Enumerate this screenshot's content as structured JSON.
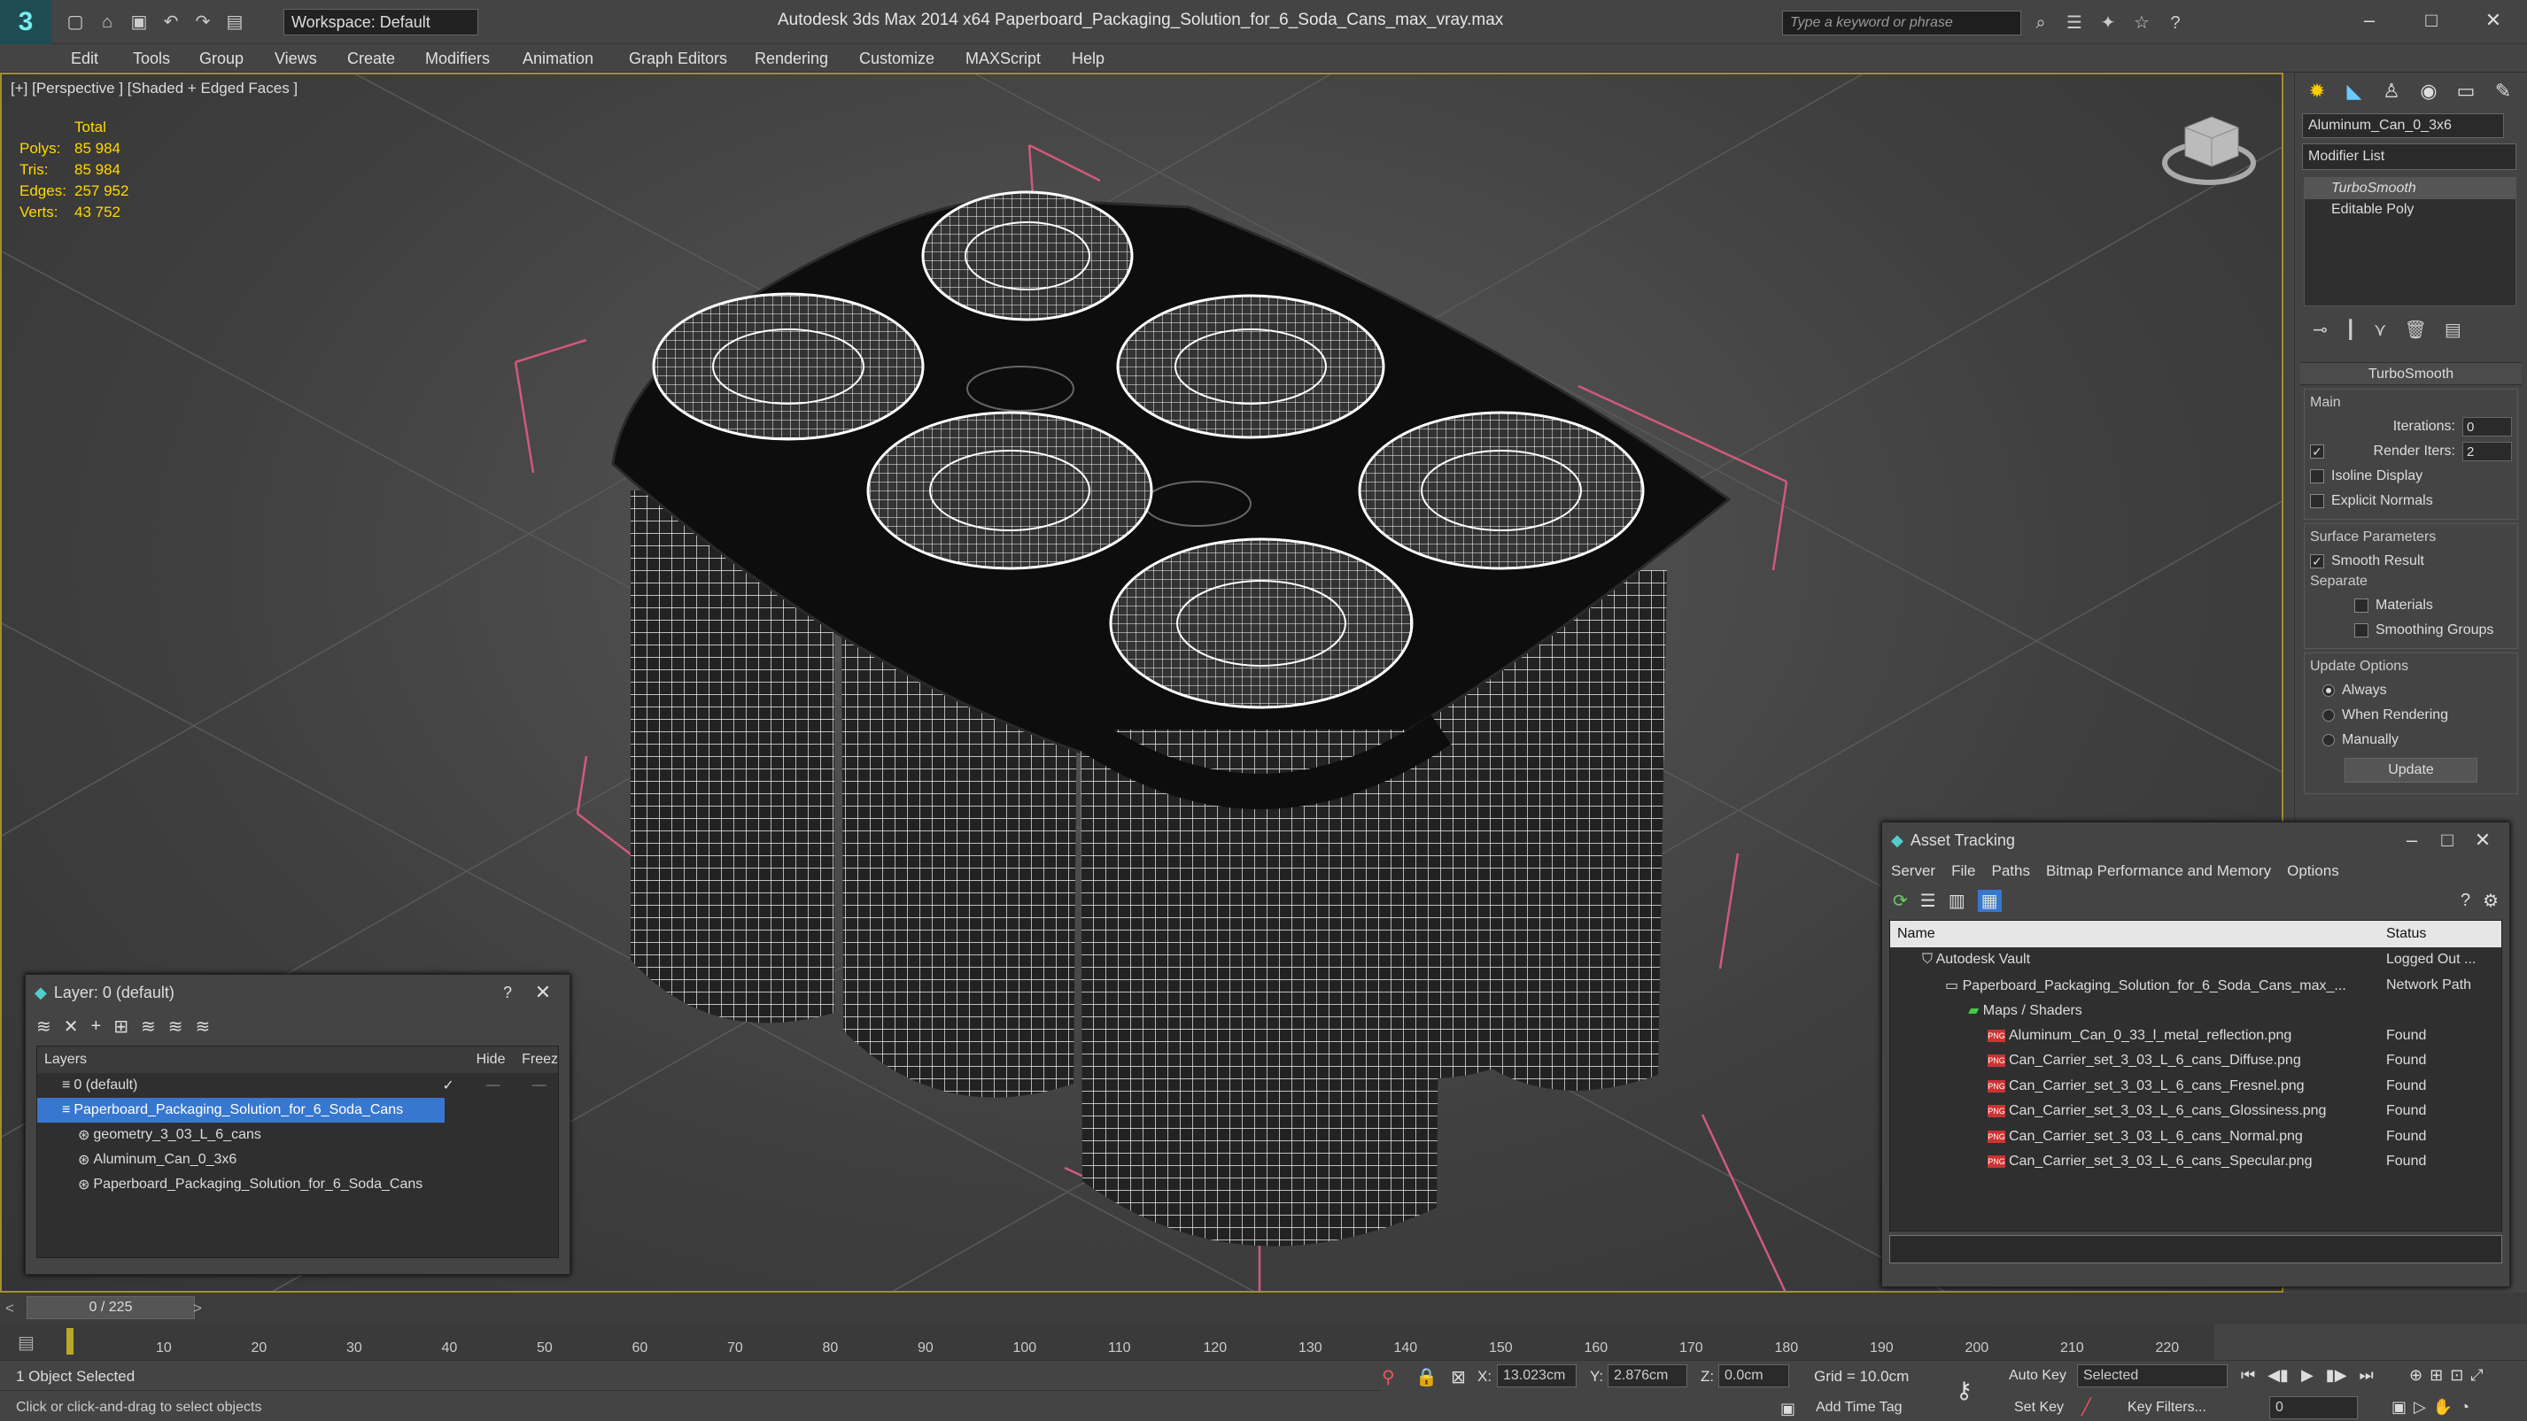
{
  "app": {
    "logo": "3",
    "workspace": "Workspace: Default",
    "title": "Autodesk 3ds Max  2014 x64     Paperboard_Packaging_Solution_for_6_Soda_Cans_max_vray.max",
    "search_placeholder": "Type a keyword or phrase"
  },
  "menu": [
    "Edit",
    "Tools",
    "Group",
    "Views",
    "Create",
    "Modifiers",
    "Animation",
    "Graph Editors",
    "Rendering",
    "Customize",
    "MAXScript",
    "Help"
  ],
  "viewport": {
    "label": "[+] [Perspective ] [Shaded + Edged Faces ]",
    "stats": {
      "total_label": "Total",
      "rows": [
        {
          "k": "Polys:",
          "v": "85 984"
        },
        {
          "k": "Tris:",
          "v": "85 984"
        },
        {
          "k": "Edges:",
          "v": "257 952"
        },
        {
          "k": "Verts:",
          "v": "43 752"
        }
      ]
    }
  },
  "command_panel": {
    "object_name": "Aluminum_Can_0_3x6",
    "modifier_list": "Modifier List",
    "stack": [
      "TurboSmooth",
      "Editable Poly"
    ],
    "rollout_title": "TurboSmooth",
    "main_label": "Main",
    "iterations_label": "Iterations:",
    "iterations": "0",
    "render_iters_label": "Render Iters:",
    "render_iters": "2",
    "isoline": "Isoline Display",
    "explicit": "Explicit Normals",
    "surface_label": "Surface Parameters",
    "smooth_result": "Smooth Result",
    "separate_label": "Separate",
    "materials": "Materials",
    "smoothing_groups": "Smoothing Groups",
    "update_options": "Update Options",
    "always": "Always",
    "when_rendering": "When Rendering",
    "manually": "Manually",
    "update_button": "Update"
  },
  "layers_panel": {
    "title": "Layer: 0 (default)",
    "col_layers": "Layers",
    "col_hide": "Hide",
    "col_freeze": "Freez",
    "rows": [
      {
        "name": "0 (default)",
        "indent": 0
      },
      {
        "name": "Paperboard_Packaging_Solution_for_6_Soda_Cans",
        "indent": 0
      },
      {
        "name": "geometry_3_03_L_6_cans",
        "indent": 1
      },
      {
        "name": "Aluminum_Can_0_3x6",
        "indent": 1
      },
      {
        "name": "Paperboard_Packaging_Solution_for_6_Soda_Cans",
        "indent": 1
      }
    ]
  },
  "asset_panel": {
    "title": "Asset Tracking",
    "menu": [
      "Server",
      "File",
      "Paths",
      "Bitmap Performance and Memory",
      "Options"
    ],
    "col_name": "Name",
    "col_status": "Status",
    "rows": [
      {
        "name": "Autodesk Vault",
        "status": "Logged Out ...",
        "indent": 1
      },
      {
        "name": "Paperboard_Packaging_Solution_for_6_Soda_Cans_max_...",
        "status": "Network Path",
        "indent": 2
      },
      {
        "name": "Maps / Shaders",
        "status": "",
        "indent": 3
      },
      {
        "name": "Aluminum_Can_0_33_l_metal_reflection.png",
        "status": "Found",
        "indent": 4
      },
      {
        "name": "Can_Carrier_set_3_03_L_6_cans_Diffuse.png",
        "status": "Found",
        "indent": 4
      },
      {
        "name": "Can_Carrier_set_3_03_L_6_cans_Fresnel.png",
        "status": "Found",
        "indent": 4
      },
      {
        "name": "Can_Carrier_set_3_03_L_6_cans_Glossiness.png",
        "status": "Found",
        "indent": 4
      },
      {
        "name": "Can_Carrier_set_3_03_L_6_cans_Normal.png",
        "status": "Found",
        "indent": 4
      },
      {
        "name": "Can_Carrier_set_3_03_L_6_cans_Specular.png",
        "status": "Found",
        "indent": 4
      }
    ]
  },
  "timeline": {
    "frame": "0 / 225",
    "ticks": [
      "10",
      "20",
      "30",
      "40",
      "50",
      "60",
      "70",
      "80",
      "90",
      "100",
      "110",
      "120",
      "130",
      "140",
      "150",
      "160",
      "170",
      "180",
      "190",
      "200",
      "210",
      "220"
    ]
  },
  "status": {
    "selected": "1 Object Selected",
    "prompt": "Click or click-and-drag to select objects",
    "x": "13.023cm",
    "y": "2.876cm",
    "z": "0.0cm",
    "grid": "Grid = 10.0cm",
    "auto_key": "Auto Key",
    "selected_dd": "Selected",
    "set_key": "Set Key",
    "key_filters": "Key Filters...",
    "add_time_tag": "Add Time Tag",
    "frame_field": "0"
  }
}
